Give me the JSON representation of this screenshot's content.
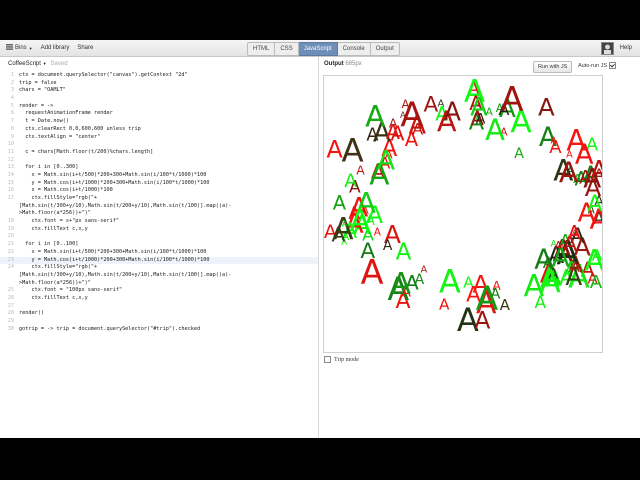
{
  "toolbar": {
    "bins_label": "Bins",
    "add_library_label": "Add library",
    "share_label": "Share",
    "tabs": [
      {
        "label": "HTML"
      },
      {
        "label": "CSS"
      },
      {
        "label": "JavaScript"
      },
      {
        "label": "Console"
      },
      {
        "label": "Output"
      }
    ],
    "active_tab": "JavaScript",
    "help_label": "Help"
  },
  "editor": {
    "language": "CoffeeScript",
    "status": "Saved",
    "lines": [
      {
        "n": "1",
        "t": "ctx = document.querySelector(\"canvas\").getContext \"2d\""
      },
      {
        "n": "2",
        "t": "trip = false"
      },
      {
        "n": "3",
        "t": "chars = \"OAMLT\""
      },
      {
        "n": "4",
        "t": ""
      },
      {
        "n": "5",
        "t": "render = ->"
      },
      {
        "n": "6",
        "t": "  requestAnimationFrame render"
      },
      {
        "n": "7",
        "t": "  t = Date.now()"
      },
      {
        "n": "8",
        "t": "  ctx.clearRect 0,0,600,600 unless trip"
      },
      {
        "n": "9",
        "t": "  ctx.textAlign = \"center\""
      },
      {
        "n": "10",
        "t": ""
      },
      {
        "n": "11",
        "t": "  c = chars[Math.floor(t/200)%chars.length]"
      },
      {
        "n": "12",
        "t": ""
      },
      {
        "n": "13",
        "t": "  for i in [0..300]"
      },
      {
        "n": "14",
        "t": "    x = Math.sin(i+t/500)*200+300+Math.sin(i/100*t/1000)*100"
      },
      {
        "n": "15",
        "t": "    y = Math.cos(i+t/1000)*200+300+Math.sin(i/100*t/1000)*100"
      },
      {
        "n": "16",
        "t": "    s = Math.cos(i+t/1000)*100"
      },
      {
        "n": "17",
        "t": "    ctx.fillStyle=\"rgb(\"+"
      },
      {
        "n": "",
        "t": "[Math.sin(t/300+y/10),Math.sin(t/200+y/10),Math.sin(t/100)].map((a)-"
      },
      {
        "n": "",
        "t": ">Math.floor(a*256))+\")\""
      },
      {
        "n": "18",
        "t": "    ctx.font = s+\"px sans-serif\""
      },
      {
        "n": "19",
        "t": "    ctx.fillText c,x,y"
      },
      {
        "n": "20",
        "t": ""
      },
      {
        "n": "21",
        "t": "  for i in [0..100]"
      },
      {
        "n": "22",
        "t": "    x = Math.sin(i+t/500)*200+300+Math.sin(i/100*t/1000)*100"
      },
      {
        "n": "23",
        "t": "    y = Math.cos(i+t/1000)*200+300+Math.sin(i/100*t/1000)*100"
      },
      {
        "n": "24",
        "t": "    ctx.fillStyle=\"rgb(\"+"
      },
      {
        "n": "",
        "t": "[Math.sin(t/300+y/10),Math.sin(t/200+y/10),Math.sin(t/100)].map((a)-"
      },
      {
        "n": "",
        "t": ">Math.floor(a*256))+\")\""
      },
      {
        "n": "25",
        "t": "    ctx.font = \"100px sans-serif\""
      },
      {
        "n": "26",
        "t": "    ctx.fillText c,x,y"
      },
      {
        "n": "27",
        "t": ""
      },
      {
        "n": "28",
        "t": "render()"
      },
      {
        "n": "29",
        "t": ""
      },
      {
        "n": "30",
        "t": "gotrip = -> trip = document.querySelector(\"#trip\").checked"
      }
    ],
    "active_line": "23"
  },
  "output": {
    "title": "Output",
    "width_text": "685px",
    "run_label": "Run with JS",
    "autorun_label": "Auto-run JS",
    "autorun_checked": true,
    "trip_label": "Trip mode",
    "trip_checked": false,
    "canvas_glyph": "A",
    "colors": {
      "accent_tab": "#6d8fb7",
      "red": "#e01010",
      "green": "#22dd22",
      "dark": "#222222"
    }
  }
}
